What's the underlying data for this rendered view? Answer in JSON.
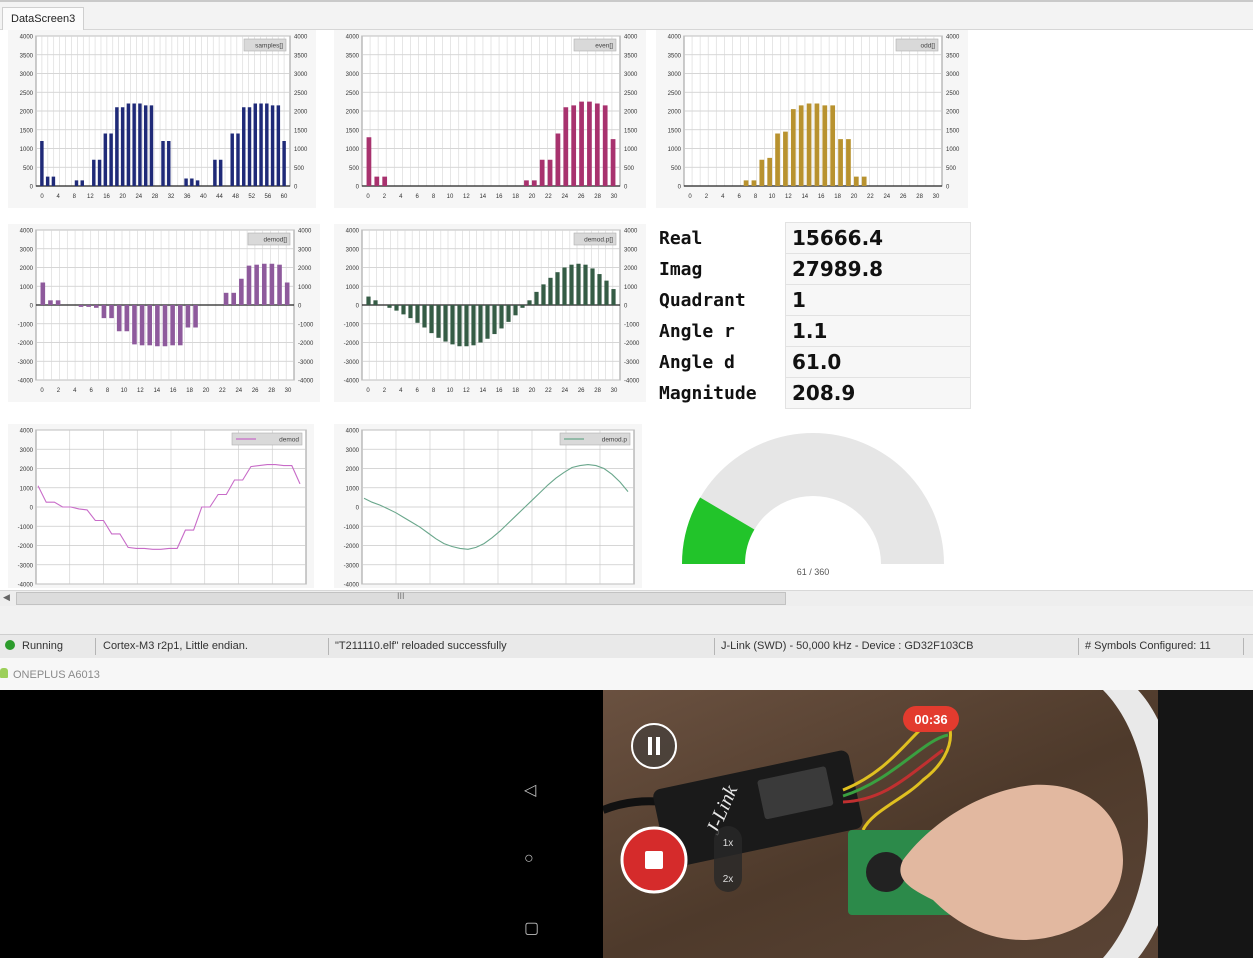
{
  "window": {
    "tab_label": "DataScreen3"
  },
  "charts": [
    {
      "id": "samples",
      "legend": "samples[]",
      "type": "bar",
      "color": "#1f2a78",
      "ytick_labels": [
        "4000",
        "3500",
        "3000",
        "2500",
        "2000",
        "1500",
        "1000",
        "500",
        "0"
      ],
      "xtick_labels": [
        "0",
        "4",
        "8",
        "12",
        "16",
        "20",
        "24",
        "28",
        "32",
        "36",
        "40",
        "44",
        "48",
        "52",
        "56",
        "60"
      ],
      "ylim": [
        0,
        4000
      ],
      "values": [
        1200,
        250,
        250,
        0,
        0,
        0,
        150,
        150,
        0,
        700,
        700,
        1400,
        1400,
        2100,
        2100,
        2200,
        2200,
        2200,
        2150,
        2150,
        0,
        1200,
        1200,
        0,
        0,
        200,
        200,
        150,
        0,
        0,
        700,
        700,
        0,
        1400,
        1400,
        2100,
        2100,
        2200,
        2200,
        2200,
        2150,
        2150,
        1200
      ]
    },
    {
      "id": "even",
      "legend": "even[]",
      "type": "bar",
      "color": "#a8326e",
      "ytick_labels": [
        "4000",
        "3500",
        "3000",
        "2500",
        "2000",
        "1500",
        "1000",
        "500",
        "0"
      ],
      "xtick_labels": [
        "0",
        "2",
        "4",
        "6",
        "8",
        "10",
        "12",
        "14",
        "16",
        "18",
        "20",
        "22",
        "24",
        "26",
        "28",
        "30"
      ],
      "ylim": [
        0,
        4000
      ],
      "values": [
        1300,
        250,
        250,
        0,
        0,
        0,
        0,
        0,
        0,
        0,
        0,
        0,
        0,
        0,
        0,
        0,
        0,
        0,
        0,
        0,
        150,
        150,
        700,
        700,
        1400,
        2100,
        2150,
        2250,
        2250,
        2200,
        2150,
        1250
      ]
    },
    {
      "id": "odd",
      "legend": "odd[]",
      "type": "bar",
      "color": "#b8922f",
      "ytick_labels": [
        "4000",
        "3500",
        "3000",
        "2500",
        "2000",
        "1500",
        "1000",
        "500",
        "0"
      ],
      "xtick_labels": [
        "0",
        "2",
        "4",
        "6",
        "8",
        "10",
        "12",
        "14",
        "16",
        "18",
        "20",
        "22",
        "24",
        "26",
        "28",
        "30"
      ],
      "ylim": [
        0,
        4000
      ],
      "values": [
        0,
        0,
        0,
        0,
        0,
        0,
        0,
        150,
        150,
        700,
        750,
        1400,
        1450,
        2050,
        2150,
        2200,
        2200,
        2150,
        2150,
        1250,
        1250,
        250,
        250,
        0,
        0,
        0,
        0,
        0,
        0,
        0,
        0,
        0
      ]
    },
    {
      "id": "demod",
      "legend": "demod[]",
      "type": "bar",
      "color": "#8e5a9c",
      "ytick_labels": [
        "4000",
        "3000",
        "2000",
        "1000",
        "0",
        "-1000",
        "-2000",
        "-3000",
        "-4000"
      ],
      "xtick_labels": [
        "0",
        "2",
        "4",
        "6",
        "8",
        "10",
        "12",
        "14",
        "16",
        "18",
        "20",
        "22",
        "24",
        "26",
        "28",
        "30"
      ],
      "ylim": [
        -4000,
        4000
      ],
      "values": [
        1200,
        250,
        250,
        0,
        0,
        -100,
        -100,
        -150,
        -700,
        -700,
        -1400,
        -1400,
        -2100,
        -2150,
        -2150,
        -2200,
        -2200,
        -2150,
        -2150,
        -1200,
        -1200,
        0,
        0,
        0,
        650,
        650,
        1400,
        2100,
        2150,
        2200,
        2200,
        2150,
        1200
      ]
    },
    {
      "id": "demod_p",
      "legend": "demod.p[]",
      "type": "bar",
      "color": "#355c45",
      "ytick_labels": [
        "4000",
        "3000",
        "2000",
        "1000",
        "0",
        "-1000",
        "-2000",
        "-3000",
        "-4000"
      ],
      "xtick_labels": [
        "0",
        "2",
        "4",
        "6",
        "8",
        "10",
        "12",
        "14",
        "16",
        "18",
        "20",
        "22",
        "24",
        "26",
        "28",
        "30"
      ],
      "ylim": [
        -4000,
        4000
      ],
      "values": [
        450,
        250,
        0,
        -150,
        -300,
        -500,
        -700,
        -950,
        -1200,
        -1500,
        -1750,
        -1950,
        -2100,
        -2200,
        -2200,
        -2150,
        -2000,
        -1800,
        -1550,
        -1250,
        -900,
        -550,
        -150,
        250,
        700,
        1100,
        1450,
        1750,
        2000,
        2150,
        2200,
        2150,
        1950,
        1650,
        1300,
        850
      ]
    },
    {
      "id": "demod_line",
      "legend": "demod",
      "type": "line",
      "color": "#c86bc8",
      "ytick_labels": [
        "4000",
        "3000",
        "2000",
        "1000",
        "0",
        "-1000",
        "-2000",
        "-3000",
        "-4000"
      ],
      "ylim": [
        -4000,
        4000
      ],
      "values": [
        1100,
        250,
        250,
        0,
        0,
        -100,
        -150,
        -700,
        -700,
        -1400,
        -1400,
        -2100,
        -2150,
        -2150,
        -2200,
        -2200,
        -2150,
        -2150,
        -1200,
        -1200,
        0,
        0,
        650,
        650,
        1400,
        1400,
        2100,
        2150,
        2200,
        2200,
        2150,
        2150,
        1200
      ]
    },
    {
      "id": "demod_p_line",
      "legend": "demod.p",
      "type": "line",
      "color": "#6aa78c",
      "ytick_labels": [
        "4000",
        "3000",
        "2000",
        "1000",
        "0",
        "-1000",
        "-2000",
        "-3000",
        "-4000"
      ],
      "ylim": [
        -4000,
        4000
      ],
      "values": [
        450,
        250,
        100,
        -100,
        -300,
        -550,
        -800,
        -1050,
        -1350,
        -1650,
        -1900,
        -2050,
        -2150,
        -2200,
        -2100,
        -1900,
        -1600,
        -1250,
        -850,
        -450,
        -50,
        350,
        750,
        1150,
        1500,
        1800,
        2050,
        2150,
        2200,
        2150,
        2000,
        1700,
        1300,
        800
      ]
    }
  ],
  "values_table": [
    {
      "label": "Real",
      "value": "15666.4"
    },
    {
      "label": "Imag",
      "value": "27989.8"
    },
    {
      "label": "Quadrant",
      "value": "1"
    },
    {
      "label": "Angle r",
      "value": "1.1"
    },
    {
      "label": "Angle d",
      "value": "61.0"
    },
    {
      "label": "Magnitude",
      "value": "208.9"
    }
  ],
  "gauge": {
    "value": 61,
    "max": 360,
    "label": "61 / 360",
    "fill_color": "#22c42a",
    "track_color": "#e8e8e8"
  },
  "scrollbar": {
    "grip": "III"
  },
  "status_bar": {
    "state": "Running",
    "core": "Cortex-M3 r2p1, Little endian.",
    "message": "\"T211110.elf\" reloaded successfully",
    "probe": "J-Link (SWD) - 50,000 kHz - Device : GD32F103CB",
    "symbols": "# Symbols Configured: 11"
  },
  "device_bar": {
    "device_name": "ONEPLUS A6013"
  },
  "phone": {
    "nav_back": "◁",
    "nav_home": "○",
    "nav_recent": "▢",
    "timer": "00:36",
    "zoom_1x": "1x",
    "zoom_2x": "2x",
    "device_label": "J-Link"
  }
}
